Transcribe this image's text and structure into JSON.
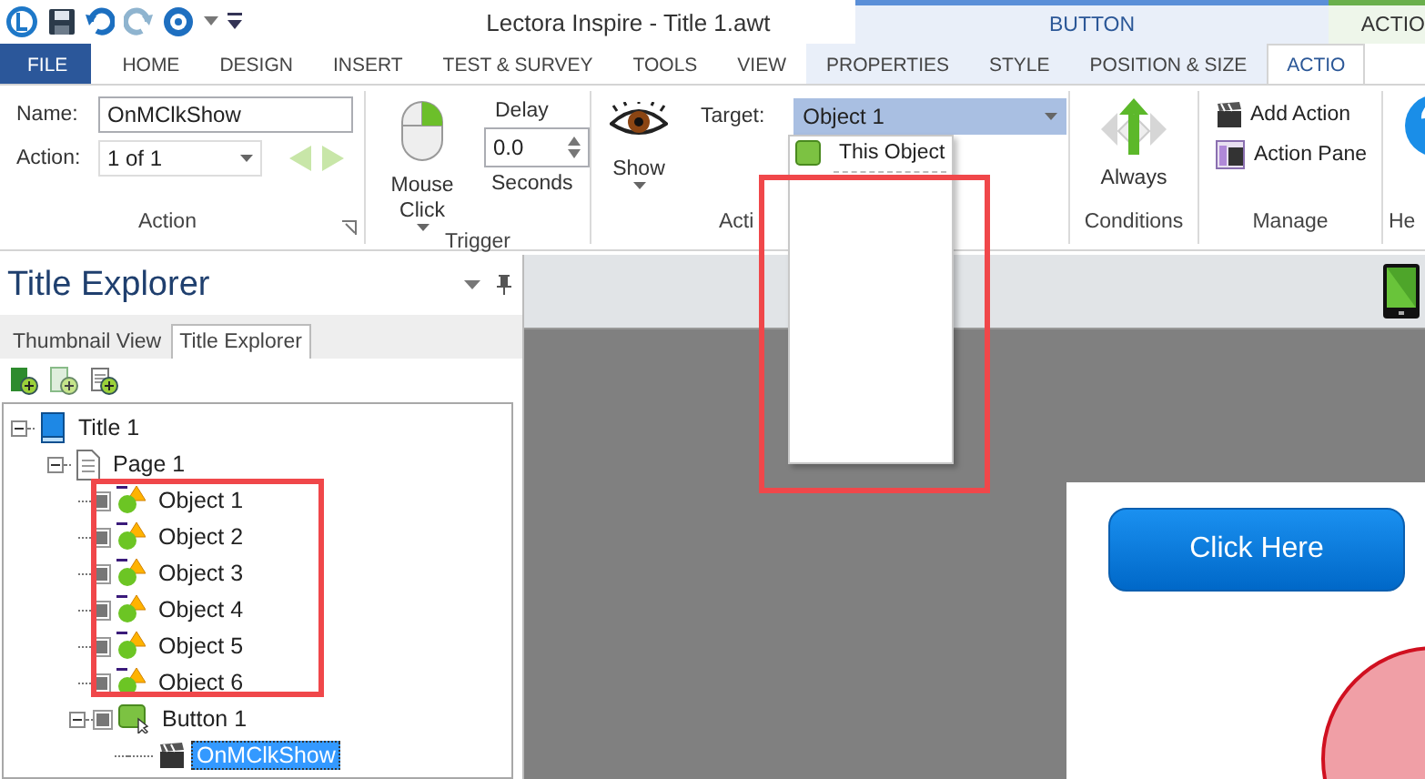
{
  "window": {
    "title": "Lectora Inspire - Title 1.awt"
  },
  "contextual_tabs": [
    {
      "label": "BUTTON",
      "kind": "button"
    },
    {
      "label": "ACTIO",
      "kind": "action"
    }
  ],
  "tabs": [
    {
      "label": "FILE",
      "kind": "file",
      "selected": false
    },
    {
      "label": "HOME",
      "kind": "main",
      "selected": false
    },
    {
      "label": "DESIGN",
      "kind": "main",
      "selected": false
    },
    {
      "label": "INSERT",
      "kind": "main",
      "selected": false
    },
    {
      "label": "TEST & SURVEY",
      "kind": "main",
      "selected": false
    },
    {
      "label": "TOOLS",
      "kind": "main",
      "selected": false
    },
    {
      "label": "VIEW",
      "kind": "main",
      "selected": false
    },
    {
      "label": "PROPERTIES",
      "kind": "button",
      "selected": false
    },
    {
      "label": "STYLE",
      "kind": "button",
      "selected": false
    },
    {
      "label": "POSITION & SIZE",
      "kind": "button",
      "selected": false
    },
    {
      "label": "ACTIO",
      "kind": "action",
      "selected": true
    }
  ],
  "ribbon": {
    "action_group": {
      "label": "Action",
      "name_label": "Name:",
      "name_value": "OnMClkShow",
      "action_label": "Action:",
      "action_value": "1 of 1",
      "prev_disabled": true,
      "next_disabled": true
    },
    "trigger_group": {
      "label": "Trigger",
      "trigger_button": "Mouse Click",
      "delay_label": "Delay",
      "delay_value": "0.0",
      "seconds_label": "Seconds"
    },
    "action_settings_group": {
      "label": "Acti",
      "action_button": "Show",
      "target_label": "Target:",
      "target_value": "Object 1",
      "target_open": true,
      "target_options": [
        {
          "label": "This Object",
          "selected": false
        }
      ]
    },
    "conditions_group": {
      "label": "Conditions",
      "button": "Always"
    },
    "manage_group": {
      "label": "Manage",
      "buttons": [
        "Add Action",
        "Action Pane"
      ]
    },
    "help_group": {
      "label": "He"
    }
  },
  "explorer": {
    "title": "Title Explorer",
    "tabs": [
      {
        "label": "Thumbnail View",
        "selected": false
      },
      {
        "label": "Title Explorer",
        "selected": true
      }
    ],
    "tree": [
      {
        "label": "Title 1",
        "kind": "title",
        "expanded": true,
        "selected": false,
        "children": [
          {
            "label": "Page 1",
            "kind": "page",
            "expanded": true,
            "selected": false,
            "children": [
              {
                "label": "Object 1",
                "kind": "object",
                "selected": false
              },
              {
                "label": "Object 2",
                "kind": "object",
                "selected": false
              },
              {
                "label": "Object 3",
                "kind": "object",
                "selected": false
              },
              {
                "label": "Object 4",
                "kind": "object",
                "selected": false
              },
              {
                "label": "Object 5",
                "kind": "object",
                "selected": false
              },
              {
                "label": "Object 6",
                "kind": "object",
                "selected": false
              },
              {
                "label": "Button 1",
                "kind": "button",
                "expanded": true,
                "selected": false,
                "children": [
                  {
                    "label": "OnMClkShow",
                    "kind": "action",
                    "selected": true
                  }
                ]
              }
            ]
          }
        ]
      }
    ]
  },
  "canvas": {
    "button": "Click Here"
  },
  "annotations": [
    {
      "kind": "frame"
    },
    {
      "kind": "frame"
    }
  ]
}
